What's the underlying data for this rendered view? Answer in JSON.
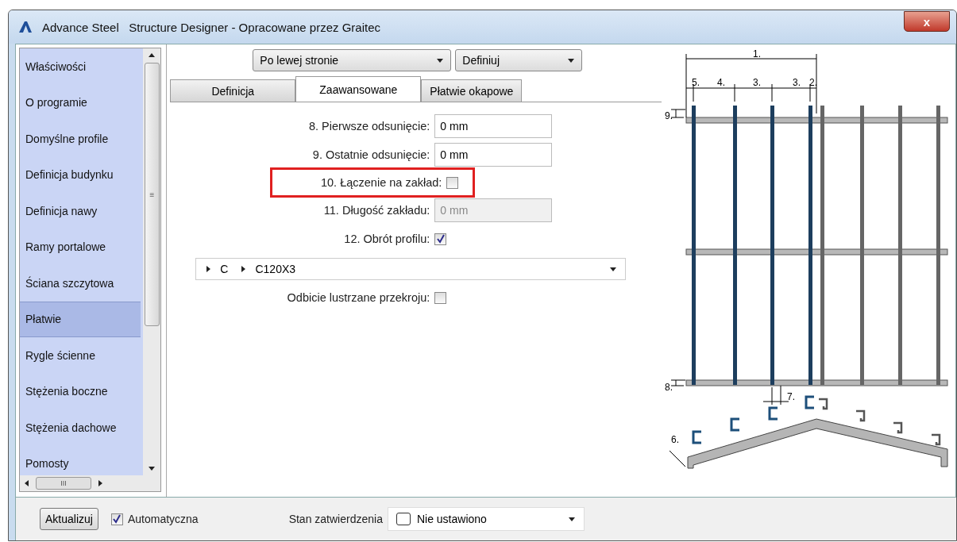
{
  "window": {
    "title": "Advance Steel   Structure Designer - Opracowane przez Graitec",
    "close": "x"
  },
  "sidebar": {
    "items": [
      {
        "label": "Właściwości",
        "selected": false
      },
      {
        "label": "O programie",
        "selected": false
      },
      {
        "label": "Domyślne profile",
        "selected": false
      },
      {
        "label": "Definicja budynku",
        "selected": false
      },
      {
        "label": "Definicja nawy",
        "selected": false
      },
      {
        "label": "Ramy portalowe",
        "selected": false
      },
      {
        "label": "Ściana szczytowa",
        "selected": false
      },
      {
        "label": "Płatwie",
        "selected": true
      },
      {
        "label": "Rygle ścienne",
        "selected": false
      },
      {
        "label": "Stężenia boczne",
        "selected": false
      },
      {
        "label": "Stężenia dachowe",
        "selected": false
      },
      {
        "label": "Pomosty",
        "selected": false
      }
    ],
    "scroll_grip": "≡",
    "hscroll_grip": "III"
  },
  "selectors": [
    {
      "value": "Po lewej stronie"
    },
    {
      "value": "Definiuj"
    }
  ],
  "tabs": [
    {
      "label": "Definicja",
      "selected": false
    },
    {
      "label": "Zaawansowane",
      "selected": true
    },
    {
      "label": "Płatwie okapowe",
      "selected": false
    }
  ],
  "form": [
    {
      "kind": "text",
      "label": "8. Pierwsze odsunięcie:",
      "value": "0 mm",
      "disabled": false,
      "highlighted": false
    },
    {
      "kind": "text",
      "label": "9. Ostatnie odsunięcie:",
      "value": "0 mm",
      "disabled": false,
      "highlighted": false
    },
    {
      "kind": "checkbox",
      "label": "10. Łączenie na zakład:",
      "checked": false,
      "highlighted": true
    },
    {
      "kind": "text",
      "label": "11. Długość zakładu:",
      "value": "0 mm",
      "disabled": true,
      "highlighted": false
    },
    {
      "kind": "checkbox",
      "label": "12. Obrót profilu:",
      "checked": true,
      "highlighted": false
    }
  ],
  "profile_path": [
    "C",
    "C120X3"
  ],
  "mirror": {
    "label": "Odbicie lustrzane przekroju:",
    "checked": false
  },
  "diagram": {
    "labels": [
      "1.",
      "5.",
      "4.",
      "3.",
      "3.",
      "2.",
      "9.",
      "8.",
      "7.",
      "6."
    ]
  },
  "footer": {
    "update_button": "Aktualizuj",
    "auto": {
      "label": "Automatyczna",
      "checked": true
    },
    "status_label": "Stan zatwierdzenia",
    "status_value": "Nie ustawiono"
  }
}
